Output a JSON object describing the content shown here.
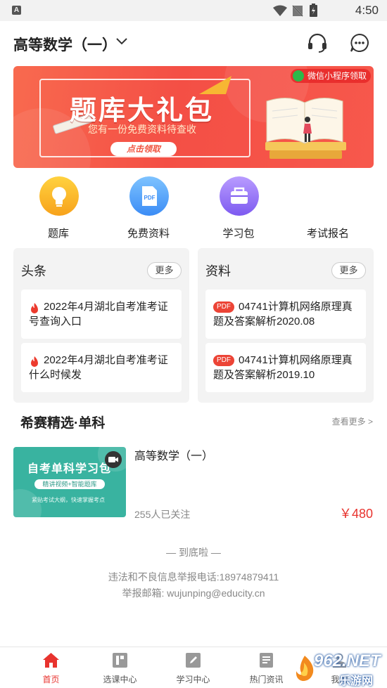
{
  "status_bar": {
    "app_letter": "A",
    "time": "4:50"
  },
  "header": {
    "title": "高等数学（一）"
  },
  "banner": {
    "title": "题库大礼包",
    "subtitle": "您有一份免费资料待查收",
    "cta": "点击领取",
    "wechat_tag": "微信小程序领取"
  },
  "quick_nav": [
    {
      "label": "题库",
      "icon": "lightbulb-icon"
    },
    {
      "label": "免费资料",
      "icon": "pdf-icon"
    },
    {
      "label": "学习包",
      "icon": "bag-icon"
    },
    {
      "label": "考试报名",
      "icon": ""
    }
  ],
  "headlines": {
    "title": "头条",
    "more": "更多",
    "items": [
      {
        "text": "2022年4月湖北自考准考证号查询入口"
      },
      {
        "text": "2022年4月湖北自考准考证什么时候发"
      }
    ]
  },
  "materials": {
    "title": "资料",
    "more": "更多",
    "badge": "PDF",
    "items": [
      {
        "text": "04741计算机网络原理真题及答案解析2020.08"
      },
      {
        "text": "04741计算机网络原理真题及答案解析2019.10"
      }
    ]
  },
  "featured": {
    "title": "希赛精选·单科",
    "more": "查看更多 >",
    "course": {
      "thumb_title": "自考单科学习包",
      "thumb_pill": "精讲视频+智能题库",
      "thumb_sub": "紧贴考试大纲，快速掌握考点",
      "title": "高等数学（一）",
      "followers": "255人已关注",
      "price": "￥480"
    }
  },
  "footer": {
    "end": "— 到底啦 —",
    "report_phone": "违法和不良信息举报电话:18974879411",
    "report_email": "举报邮箱:  wujunping@educity.cn"
  },
  "bottom_nav": [
    {
      "label": "首页",
      "active": true
    },
    {
      "label": "选课中心",
      "active": false
    },
    {
      "label": "学习中心",
      "active": false
    },
    {
      "label": "热门资讯",
      "active": false
    },
    {
      "label": "我的",
      "active": false
    }
  ],
  "watermark": {
    "brand": "962.NET",
    "sub": "乐游网"
  },
  "colors": {
    "accent": "#e8332e",
    "banner": "#f44f45",
    "teal": "#39b3a0"
  }
}
